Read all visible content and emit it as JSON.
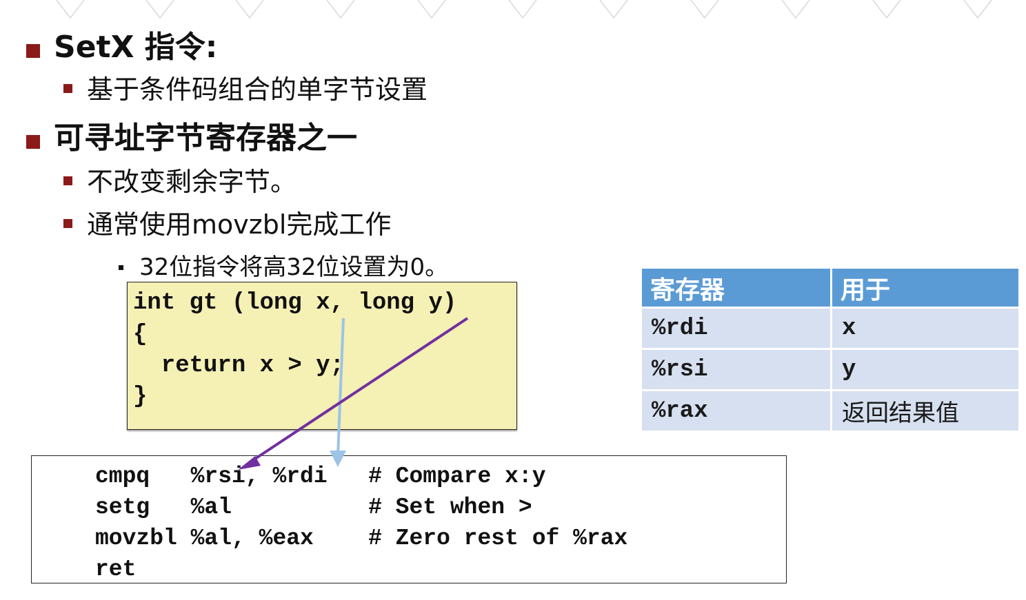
{
  "bullets": {
    "setx_title": "SetX 指令:",
    "setx_sub": "基于条件码组合的单字节设置",
    "reg_title": "可寻址字节寄存器之一",
    "reg_sub1": "不改变剩余字节。",
    "reg_sub2": "通常使用movzbl完成工作",
    "reg_sub3": "32位指令将高32位设置为0。"
  },
  "c_code": {
    "lines": [
      "int gt (long x, long y)",
      "{",
      "  return x > y;",
      "}"
    ]
  },
  "asm_code": {
    "lines": [
      "cmpq   %rsi, %rdi   # Compare x:y",
      "setg   %al          # Set when >",
      "movzbl %al, %eax    # Zero rest of %rax",
      "ret"
    ]
  },
  "register_table": {
    "headers": [
      "寄存器",
      "用于"
    ],
    "rows": [
      [
        "%rdi",
        "x"
      ],
      [
        "%rsi",
        "y"
      ],
      [
        "%rax",
        "返回结果值"
      ]
    ]
  },
  "colors": {
    "bullet": "#8b1a1a",
    "table_header": "#5b9bd5",
    "table_cell": "#d6e0f0",
    "code_bg": "#f5f0b4",
    "arrow_purple": "#7030a0",
    "arrow_blue": "#9dc3e6"
  },
  "icons": [
    "bullet-square-icon",
    "arrow-y-to-rsi-icon",
    "arrow-x-to-rdi-icon"
  ]
}
